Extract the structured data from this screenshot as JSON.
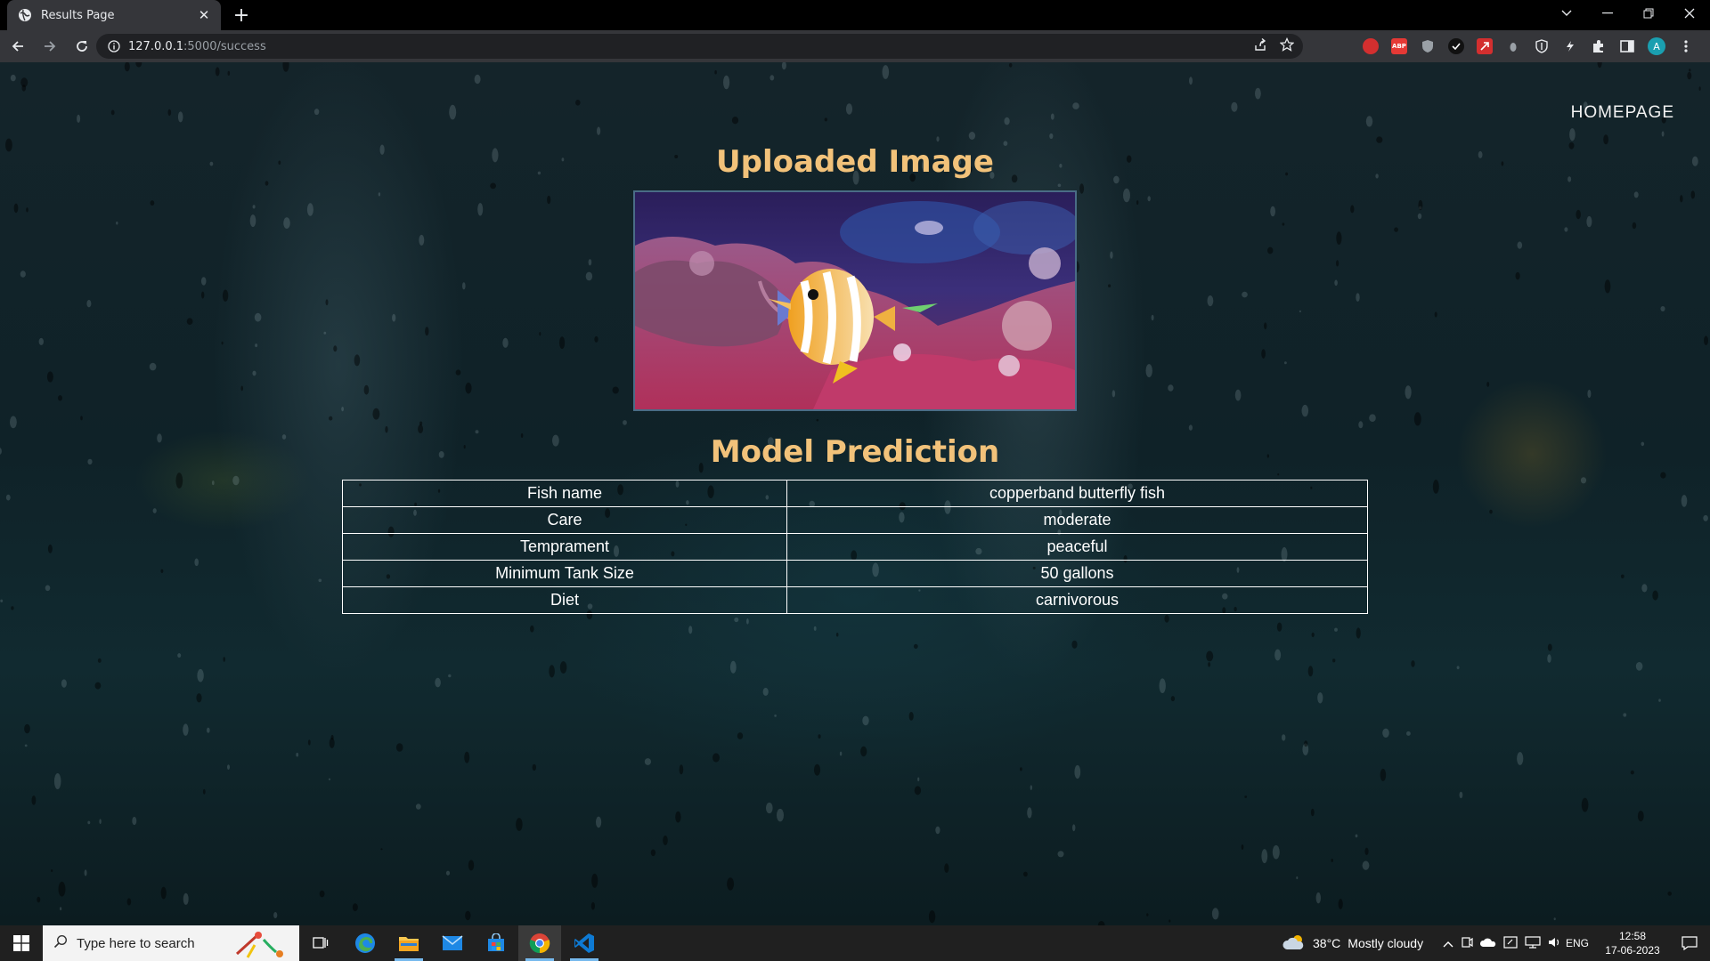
{
  "browser": {
    "tab_title": "Results Page",
    "url_host": "127.0.0.1",
    "url_rest": ":5000/success"
  },
  "page": {
    "nav_link": "HOMEPAGE",
    "uploaded_heading": "Uploaded Image",
    "prediction_heading": "Model Prediction",
    "prediction_rows": [
      {
        "label": "Fish name",
        "value": "copperband butterfly fish"
      },
      {
        "label": "Care",
        "value": "moderate"
      },
      {
        "label": "Temprament",
        "value": "peaceful"
      },
      {
        "label": "Minimum Tank Size",
        "value": "50 gallons"
      },
      {
        "label": "Diet",
        "value": "carnivorous"
      }
    ]
  },
  "taskbar": {
    "search_placeholder": "Type here to search",
    "weather_temp": "38°C",
    "weather_text": "Mostly cloudy",
    "language": "ENG",
    "time": "12:58",
    "date": "17-06-2023"
  },
  "colors": {
    "heading": "#f2c27a",
    "accent_profile": "#1a9fb0"
  }
}
